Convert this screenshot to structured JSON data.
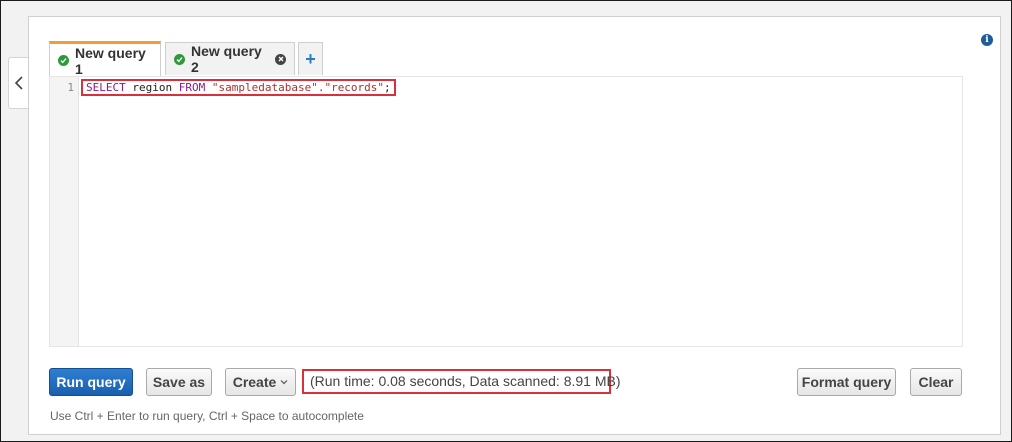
{
  "tabs": [
    {
      "label": "New query 1",
      "active": true,
      "status_icon": "check-circle-icon"
    },
    {
      "label": "New query 2",
      "active": false,
      "status_icon": "check-circle-icon",
      "close_icon": "close-circle-icon"
    }
  ],
  "add_tab_label": "+",
  "editor": {
    "line_number": "1",
    "code": {
      "kw1": "SELECT",
      "col": " region ",
      "kw2": "FROM",
      "space": " ",
      "table": "\"sampledatabase\".\"records\"",
      "end": ";"
    }
  },
  "toolbar": {
    "run_label": "Run query",
    "save_label": "Save as",
    "create_label": "Create",
    "format_label": "Format query",
    "clear_label": "Clear"
  },
  "status": "(Run time: 0.08 seconds, Data scanned: 8.91 MB)",
  "hint": "Use Ctrl + Enter to run query, Ctrl + Space to autocomplete",
  "icons": {
    "collapse": "chevron-left-icon",
    "info": "info-icon",
    "dropdown": "chevron-down-icon"
  },
  "colors": {
    "accent_tab": "#f0a032",
    "primary_button": "#1a5fae",
    "highlight_box": "#d9303a",
    "success": "#2d9a3a"
  }
}
